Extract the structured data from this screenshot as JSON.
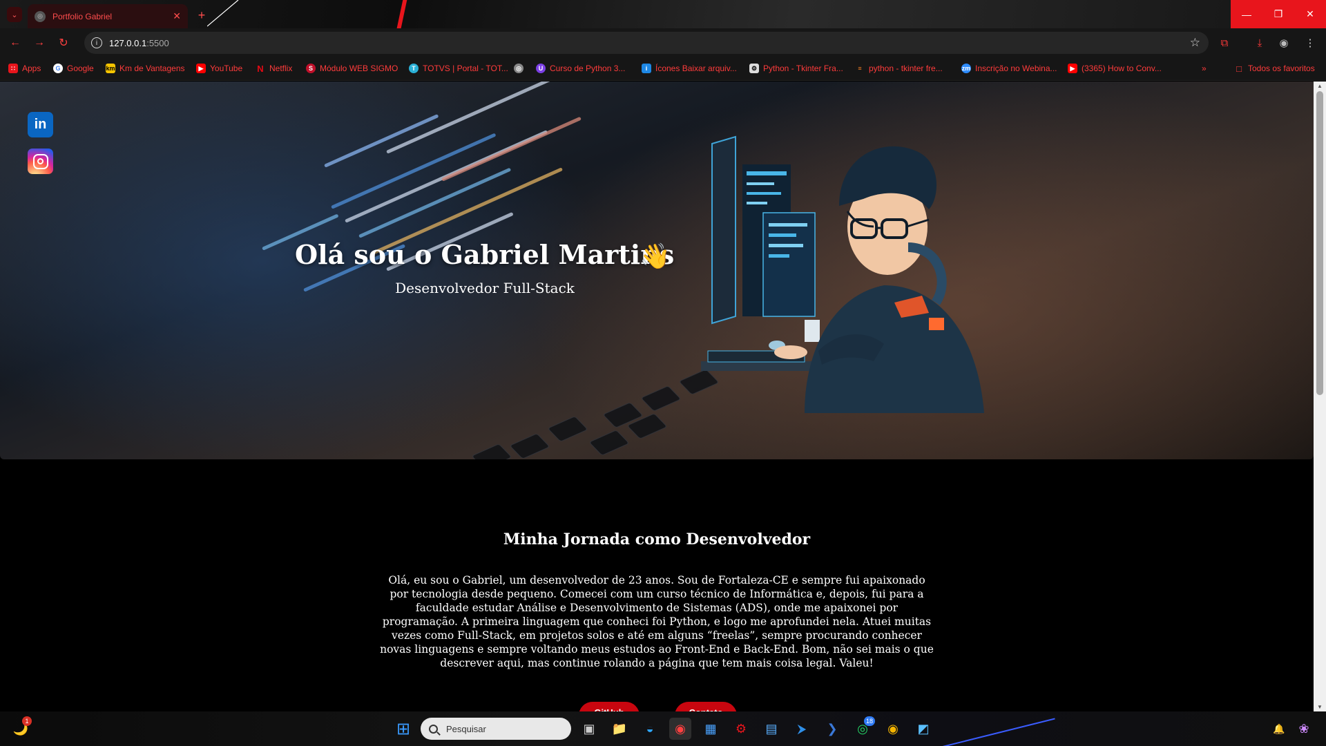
{
  "browser": {
    "tab_title": "Portfolio Gabriel",
    "url_host": "127.0.0.1",
    "url_port": ":5500",
    "accent": "#e8151c"
  },
  "bookmarks": [
    {
      "label": "Apps",
      "icon": "apps-grid-icon"
    },
    {
      "label": "Google",
      "icon": "google-icon"
    },
    {
      "label": "Km de Vantagens",
      "icon": "km-icon"
    },
    {
      "label": "YouTube",
      "icon": "youtube-icon"
    },
    {
      "label": "Netflix",
      "icon": "netflix-icon"
    },
    {
      "label": "Módulo WEB SIGMO",
      "icon": "sigmo-icon"
    },
    {
      "label": "TOTVS | Portal - TOT...",
      "icon": "totvs-icon"
    },
    {
      "label": "",
      "icon": "globe-icon"
    },
    {
      "label": "Curso de Python 3...",
      "icon": "python-course-icon"
    },
    {
      "label": "Ícones Baixar arquiv...",
      "icon": "icons-site-icon"
    },
    {
      "label": "Python - Tkinter Fra...",
      "icon": "tkinter-icon"
    },
    {
      "label": "python - tkinter fre...",
      "icon": "stackoverflow-icon"
    },
    {
      "label": "Inscrição no Webina...",
      "icon": "zoom-icon"
    },
    {
      "label": "(3365) How to Conv...",
      "icon": "youtube-icon"
    }
  ],
  "all_bookmarks_label": "Todos os favoritos",
  "hero": {
    "title": "Olá sou o Gabriel Martins",
    "subtitle": "Desenvolvedor Full-Stack",
    "wave": "👋"
  },
  "journey": {
    "title": "Minha Jornada como Desenvolvedor",
    "text": "Olá, eu sou o Gabriel, um desenvolvedor de 23 anos. Sou de Fortaleza-CE e sempre fui apaixonado por tecnologia desde pequeno. Comecei com um curso técnico de Informática e, depois, fui para a faculdade estudar Análise e Desenvolvimento de Sistemas (ADS), onde me apaixonei por programação. A primeira linguagem que conheci foi Python, e logo me aprofundei nela. Atuei muitas vezes como Full-Stack, em projetos solos e até em alguns “freelas”, sempre procurando conhecer novas linguagens e sempre voltando meus estudos ao Front-End e Back-End. Bom, não sei mais o que descrever aqui, mas continue rolando a página que tem mais coisa legal. Valeu!"
  },
  "cta_buttons": [
    {
      "label": "GitHub"
    },
    {
      "label": "Contato"
    }
  ],
  "taskbar": {
    "search_placeholder": "Pesquisar",
    "weather_badge": "1",
    "whatsapp_badge": "18"
  }
}
